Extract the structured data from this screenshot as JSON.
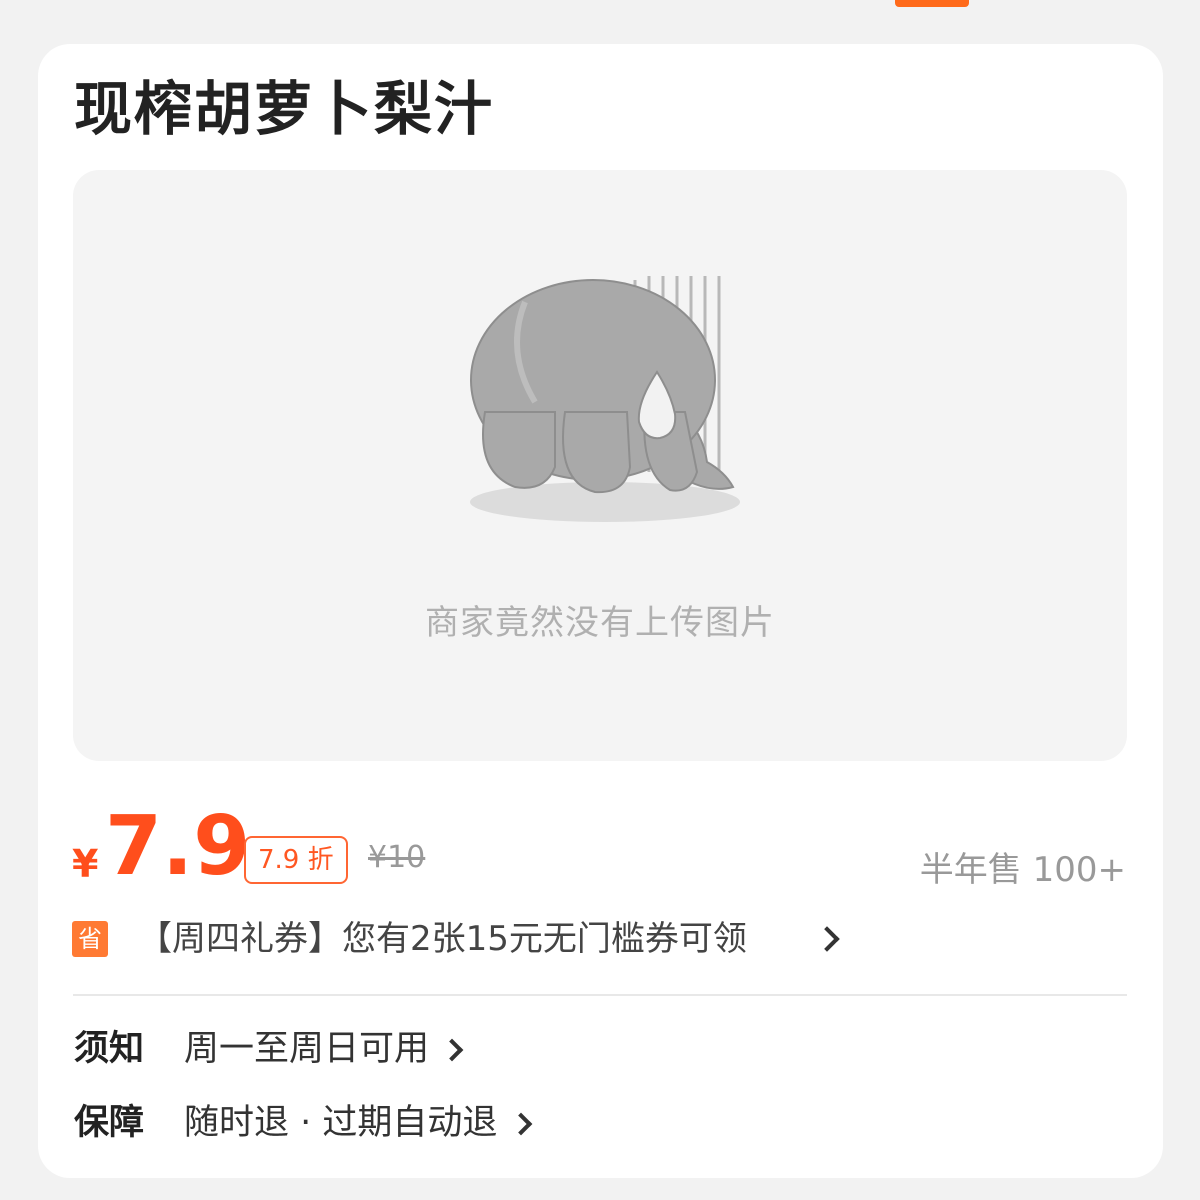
{
  "product": {
    "title": "现榨胡萝卜梨汁"
  },
  "image_placeholder": {
    "text": "商家竟然没有上传图片",
    "illustration": "sad-elephant-illustration"
  },
  "pricing": {
    "currency_symbol": "¥",
    "price": "7.9",
    "discount_label": "7.9 折",
    "original_price": "¥10",
    "sales_text": "半年售 100+"
  },
  "coupon": {
    "badge": "省",
    "text": "【周四礼券】您有2张15元无门槛券可领"
  },
  "info": {
    "notice_label": "须知",
    "notice_value": "周一至周日可用",
    "guarantee_label": "保障",
    "guarantee_value": "随时退 · 过期自动退"
  },
  "colors": {
    "accent": "#ff4e1c",
    "badge": "#ff7a33",
    "background": "#f2f2f2",
    "card": "#ffffff"
  }
}
